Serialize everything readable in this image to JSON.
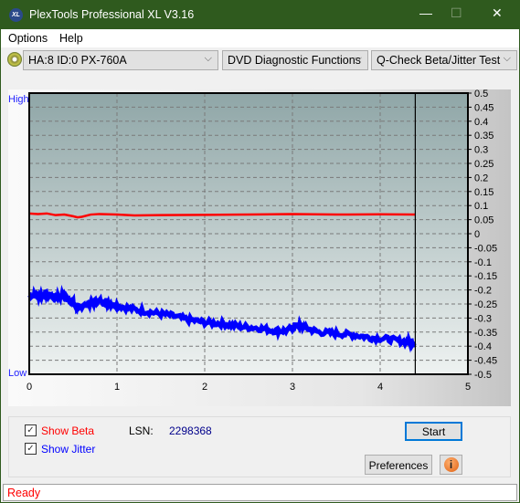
{
  "window": {
    "title": "PlexTools Professional XL V3.16",
    "logo_text": "XL",
    "minimize": "—",
    "maximize": "☐",
    "close": "✕"
  },
  "menu": {
    "options": "Options",
    "help": "Help"
  },
  "toolbar": {
    "drive": "HA:8 ID:0  PX-760A",
    "category": "DVD Diagnostic Functions",
    "test": "Q-Check Beta/Jitter Test",
    "chevron": "⌵"
  },
  "chart_data": {
    "type": "line",
    "x_ticks": [
      "0",
      "1",
      "2",
      "3",
      "4",
      "5"
    ],
    "xlim": [
      0,
      5
    ],
    "y_right_ticks": [
      "0.5",
      "0.45",
      "0.4",
      "0.35",
      "0.3",
      "0.25",
      "0.2",
      "0.15",
      "0.1",
      "0.05",
      "0",
      "-0.05",
      "-0.1",
      "-0.15",
      "-0.2",
      "-0.25",
      "-0.3",
      "-0.35",
      "-0.4",
      "-0.45",
      "-0.5"
    ],
    "ylim": [
      -0.5,
      0.5
    ],
    "y_left_top": "High",
    "y_left_bottom": "Low",
    "grid": true,
    "marker_x": 4.4,
    "colors": {
      "beta": "#ff0000",
      "jitter": "#0000ff"
    },
    "series": [
      {
        "key": "beta",
        "x": [
          0,
          0.1,
          0.2,
          0.3,
          0.4,
          0.5,
          0.55,
          0.6,
          0.7,
          0.8,
          1.0,
          1.2,
          1.5,
          2.0,
          2.5,
          3.0,
          3.5,
          4.0,
          4.4
        ],
        "values": [
          0.072,
          0.07,
          0.072,
          0.066,
          0.068,
          0.062,
          0.058,
          0.06,
          0.068,
          0.07,
          0.068,
          0.065,
          0.066,
          0.067,
          0.068,
          0.07,
          0.068,
          0.069,
          0.068
        ]
      },
      {
        "key": "jitter",
        "x": [
          0,
          0.1,
          0.2,
          0.3,
          0.4,
          0.5,
          0.55,
          0.6,
          0.7,
          0.8,
          0.9,
          1.0,
          1.2,
          1.4,
          1.6,
          1.8,
          2.0,
          2.2,
          2.4,
          2.6,
          2.8,
          2.95,
          3.05,
          3.15,
          3.3,
          3.5,
          3.7,
          3.9,
          4.1,
          4.3,
          4.4
        ],
        "values": [
          -0.22,
          -0.22,
          -0.215,
          -0.225,
          -0.22,
          -0.245,
          -0.265,
          -0.26,
          -0.245,
          -0.24,
          -0.245,
          -0.255,
          -0.27,
          -0.28,
          -0.29,
          -0.305,
          -0.315,
          -0.32,
          -0.33,
          -0.335,
          -0.345,
          -0.345,
          -0.325,
          -0.335,
          -0.35,
          -0.355,
          -0.36,
          -0.37,
          -0.375,
          -0.385,
          -0.385
        ]
      }
    ]
  },
  "controls": {
    "show_beta": "Show Beta",
    "show_jitter": "Show Jitter",
    "show_beta_checked": true,
    "show_jitter_checked": true,
    "lsn_label": "LSN:",
    "lsn_value": "2298368",
    "start": "Start",
    "preferences": "Preferences",
    "info_icon": "i"
  },
  "status": "Ready"
}
